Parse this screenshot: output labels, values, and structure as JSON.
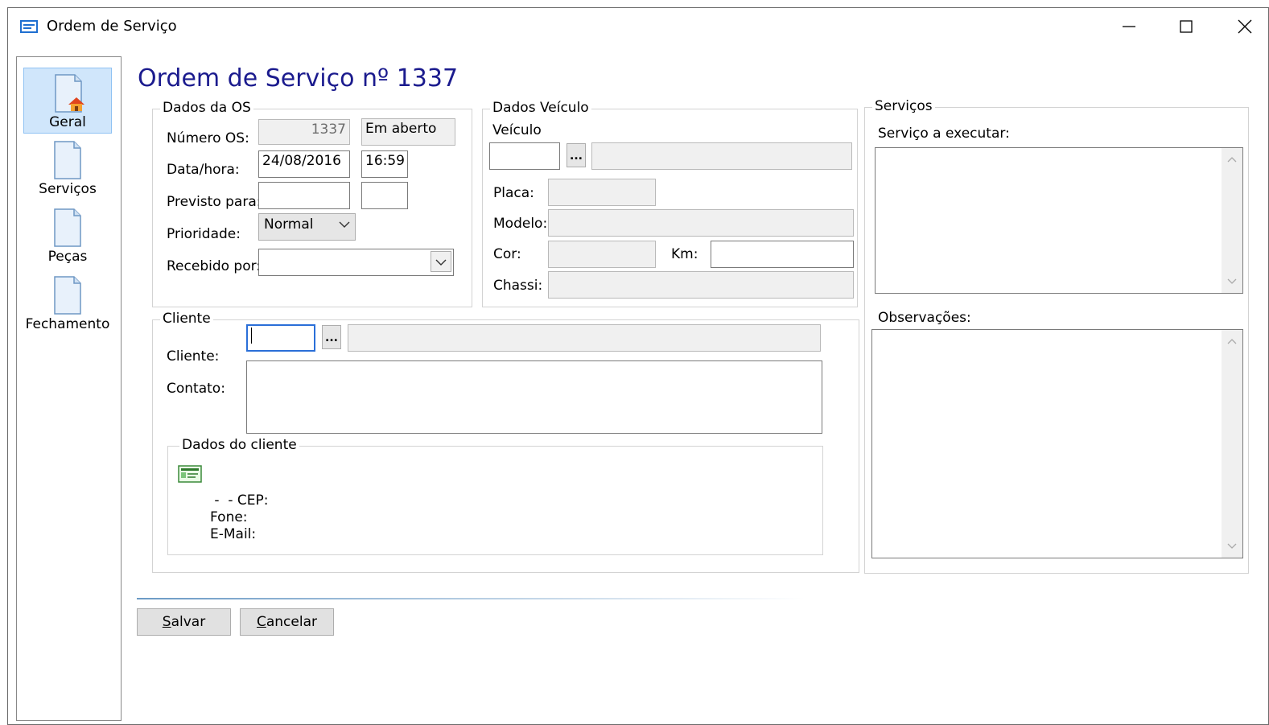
{
  "window": {
    "title": "Ordem de Serviço"
  },
  "nav": {
    "items": [
      {
        "label": "Geral",
        "active": true
      },
      {
        "label": "Serviços",
        "active": false
      },
      {
        "label": "Peças",
        "active": false
      },
      {
        "label": "Fechamento",
        "active": false
      }
    ]
  },
  "heading": "Ordem de Serviço nº 1337",
  "dados_os": {
    "legend": "Dados da OS",
    "numero_label": "Número OS:",
    "numero_value": "1337",
    "status_value": "Em aberto",
    "datahora_label": "Data/hora:",
    "data_value": "24/08/2016",
    "hora_value": "16:59",
    "previsto_label": "Previsto para:",
    "previsto_data": "",
    "previsto_hora": "",
    "prioridade_label": "Prioridade:",
    "prioridade_value": "Normal",
    "recebido_label": "Recebido por:",
    "recebido_value": ""
  },
  "dados_veiculo": {
    "legend": "Dados Veículo",
    "veiculo_label": "Veículo",
    "veiculo_code": "",
    "veiculo_desc": "",
    "lookup_label": "...",
    "placa_label": "Placa:",
    "placa_value": "",
    "modelo_label": "Modelo:",
    "modelo_value": "",
    "cor_label": "Cor:",
    "cor_value": "",
    "km_label": "Km:",
    "km_value": "",
    "chassi_label": "Chassi:",
    "chassi_value": ""
  },
  "cliente": {
    "legend": "Cliente",
    "cliente_label": "Cliente:",
    "cliente_code": "",
    "cliente_name": "",
    "lookup_label": "...",
    "contato_label": "Contato:",
    "contato_value": "",
    "dados_legend": "Dados do cliente",
    "cep_line": " -  - CEP:",
    "fone_line": "Fone:",
    "email_line": "E-Mail:"
  },
  "servicos": {
    "legend": "Serviços",
    "servico_label": "Serviço a executar:",
    "servico_value": "",
    "obs_label": "Observações:",
    "obs_value": ""
  },
  "buttons": {
    "salvar_key": "S",
    "salvar_rest": "alvar",
    "cancelar_key": "C",
    "cancelar_rest": "ancelar"
  }
}
